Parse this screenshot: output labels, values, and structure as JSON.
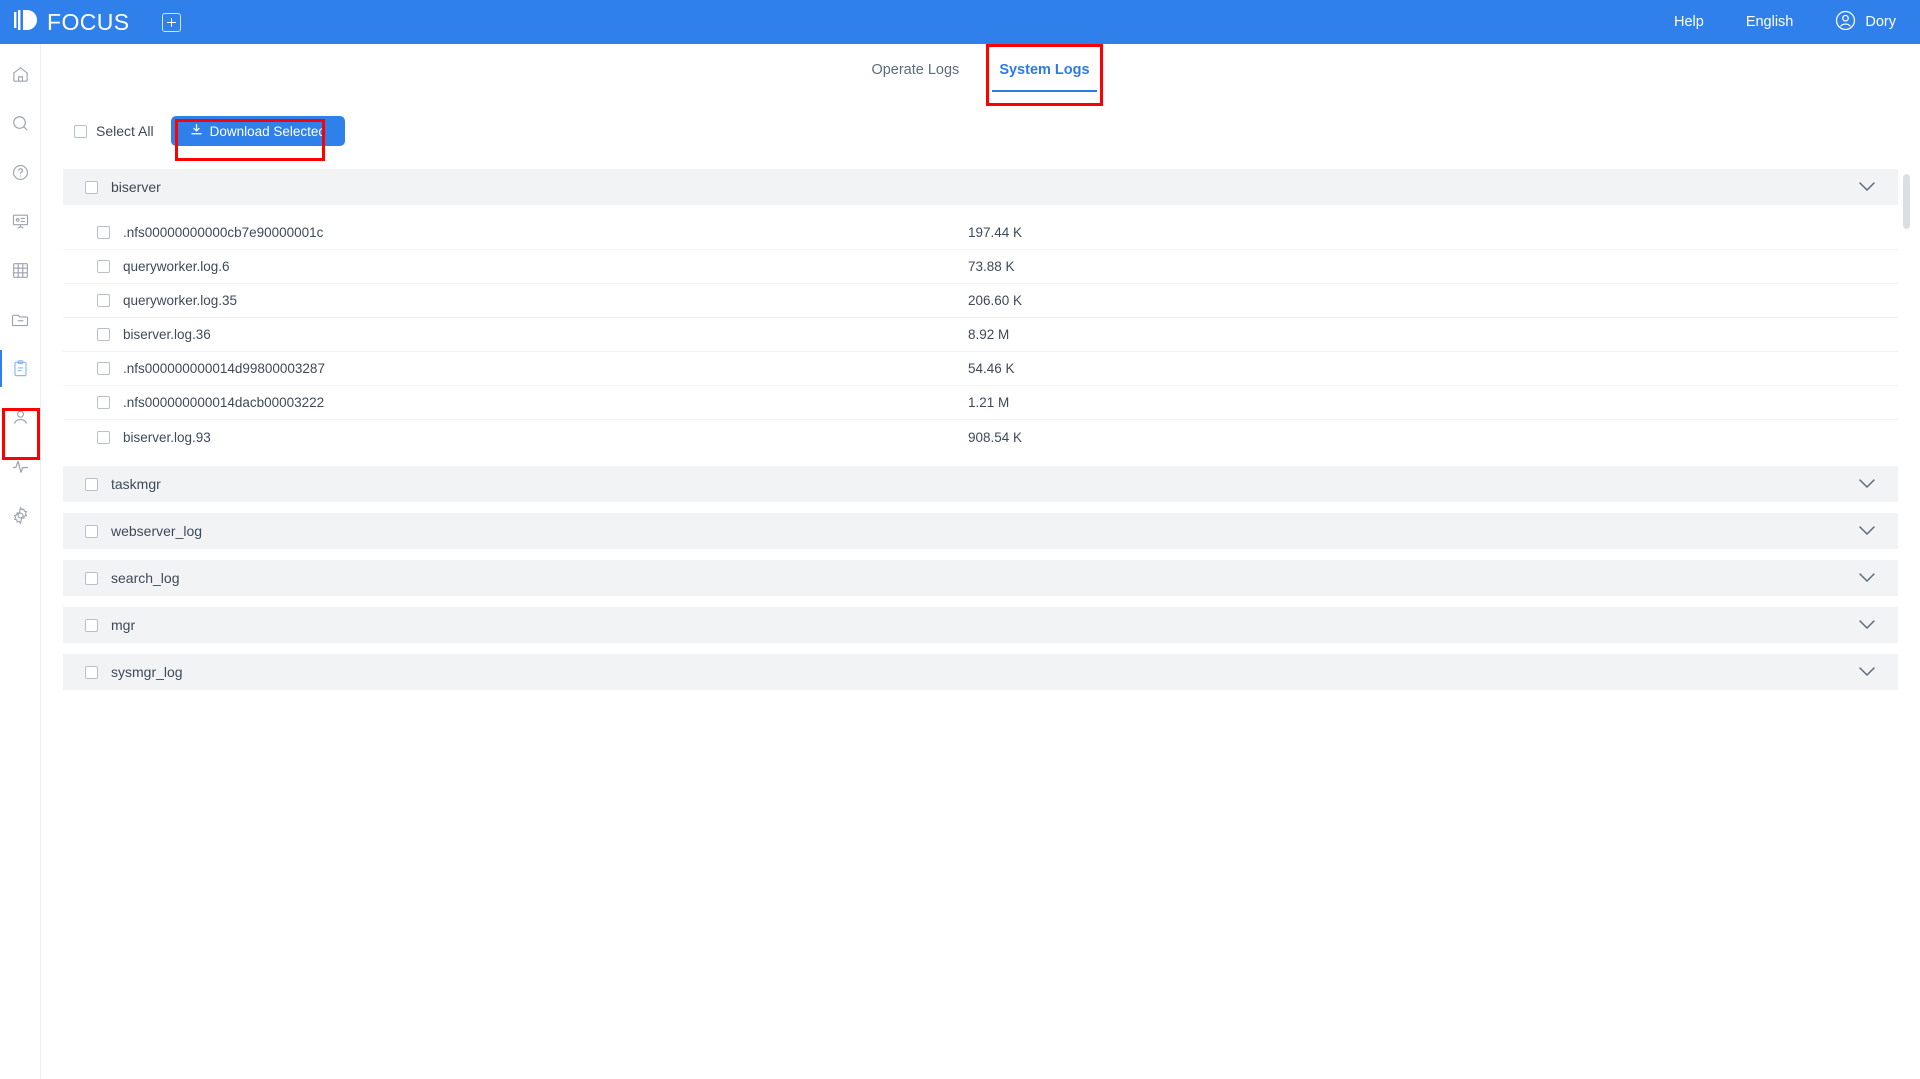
{
  "header": {
    "brand": "FOCUS",
    "add_icon": "plus-square-icon",
    "help": "Help",
    "language": "English",
    "user": "Dory",
    "accent": "#3080ec"
  },
  "sidebar": {
    "items": [
      {
        "icon": "home-icon",
        "name": "home"
      },
      {
        "icon": "search-icon",
        "name": "search"
      },
      {
        "icon": "question-icon",
        "name": "help"
      },
      {
        "icon": "presentation-icon",
        "name": "dashboard"
      },
      {
        "icon": "grid-icon",
        "name": "table"
      },
      {
        "icon": "folder-icon",
        "name": "folder"
      },
      {
        "icon": "clipboard-icon",
        "name": "logs",
        "active": true
      },
      {
        "icon": "user-icon",
        "name": "users"
      },
      {
        "icon": "activity-icon",
        "name": "monitor"
      },
      {
        "icon": "gear-icon",
        "name": "settings"
      }
    ]
  },
  "tabs": [
    {
      "label": "Operate Logs",
      "active": false
    },
    {
      "label": "System Logs",
      "active": true
    }
  ],
  "toolbar": {
    "select_all_label": "Select All",
    "download_label": "Download Selected",
    "download_icon": "download-icon"
  },
  "groups": [
    {
      "name": "biserver",
      "expanded": true,
      "chevron": "chevron-down-icon",
      "files": [
        {
          "name": ".nfs00000000000cb7e90000001c",
          "size": "197.44 K"
        },
        {
          "name": "queryworker.log.6",
          "size": "73.88 K"
        },
        {
          "name": "queryworker.log.35",
          "size": "206.60 K"
        },
        {
          "name": "biserver.log.36",
          "size": "8.92 M"
        },
        {
          "name": ".nfs000000000014d99800003287",
          "size": "54.46 K"
        },
        {
          "name": ".nfs000000000014dacb00003222",
          "size": "1.21 M"
        },
        {
          "name": "biserver.log.93",
          "size": "908.54 K"
        }
      ]
    },
    {
      "name": "taskmgr",
      "expanded": false,
      "chevron": "chevron-down-icon",
      "files": []
    },
    {
      "name": "webserver_log",
      "expanded": false,
      "chevron": "chevron-down-icon",
      "files": []
    },
    {
      "name": "search_log",
      "expanded": false,
      "chevron": "chevron-down-icon",
      "files": []
    },
    {
      "name": "mgr",
      "expanded": false,
      "chevron": "chevron-down-icon",
      "files": []
    },
    {
      "name": "sysmgr_log",
      "expanded": false,
      "chevron": "chevron-down-icon",
      "files": []
    }
  ],
  "annotations": {
    "highlight_color": "#ff0000",
    "boxes": [
      "sidebar-logs-item",
      "download-selected-button",
      "system-logs-tab"
    ]
  }
}
